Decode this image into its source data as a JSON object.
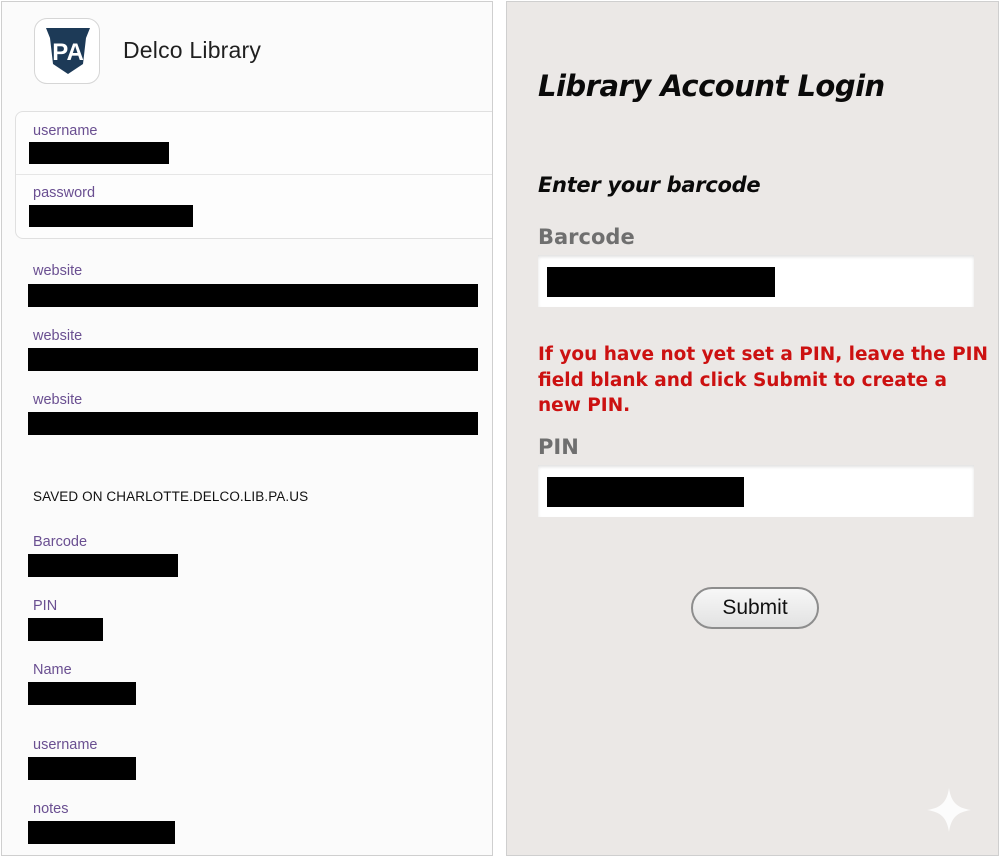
{
  "left": {
    "app_icon_text": "PA",
    "app_title": "Delco Library",
    "credentials": {
      "username_label": "username",
      "password_label": "password"
    },
    "websites": [
      {
        "label": "website"
      },
      {
        "label": "website"
      },
      {
        "label": "website"
      }
    ],
    "saved_heading": "SAVED ON CHARLOTTE.DELCO.LIB.PA.US",
    "saved_fields": [
      {
        "label": "Barcode"
      },
      {
        "label": "PIN"
      },
      {
        "label": "Name"
      },
      {
        "label": "username"
      },
      {
        "label": "notes"
      }
    ],
    "colors": {
      "label": "#6a4f91",
      "keystone": "#1d3a57"
    }
  },
  "right": {
    "title": "Library Account Login",
    "subtitle": "Enter your barcode",
    "barcode_label": "Barcode",
    "warning": "If you have not yet set a PIN, leave the PIN field blank and click Submit to create a new PIN.",
    "pin_label": "PIN",
    "submit_label": "Submit",
    "colors": {
      "warning": "#cc1111",
      "background": "#ebe8e6"
    }
  }
}
